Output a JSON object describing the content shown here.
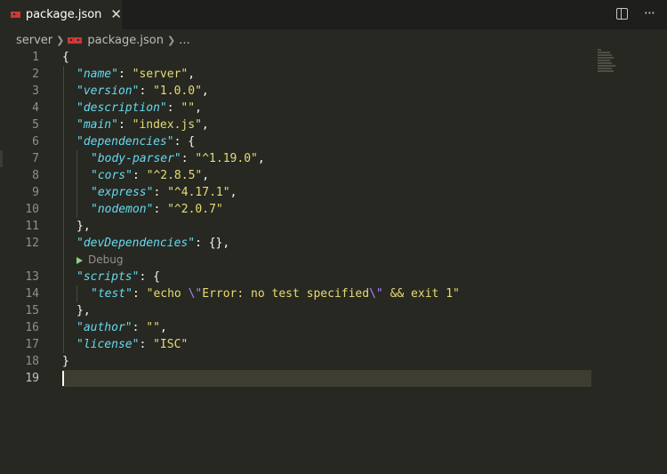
{
  "tab": {
    "label": "package.json",
    "close": "✕"
  },
  "actions": {
    "split": "split-editor",
    "more": "···"
  },
  "breadcrumb": {
    "folder": "server",
    "file": "package.json",
    "more": "..."
  },
  "codelens": {
    "debug_label": "Debug"
  },
  "lines": {
    "l1": {
      "num": "1",
      "t0": "{"
    },
    "l2": {
      "num": "2",
      "k": "\"name\"",
      "p": ": ",
      "v": "\"server\"",
      "e": ","
    },
    "l3": {
      "num": "3",
      "k": "\"version\"",
      "p": ": ",
      "v": "\"1.0.0\"",
      "e": ","
    },
    "l4": {
      "num": "4",
      "k": "\"description\"",
      "p": ": ",
      "v": "\"\"",
      "e": ","
    },
    "l5": {
      "num": "5",
      "k": "\"main\"",
      "p": ": ",
      "v": "\"index.js\"",
      "e": ","
    },
    "l6": {
      "num": "6",
      "k": "\"dependencies\"",
      "p": ": {"
    },
    "l7": {
      "num": "7",
      "k": "\"body-parser\"",
      "p": ": ",
      "v": "\"^1.19.0\"",
      "e": ","
    },
    "l8": {
      "num": "8",
      "k": "\"cors\"",
      "p": ": ",
      "v": "\"^2.8.5\"",
      "e": ","
    },
    "l9": {
      "num": "9",
      "k": "\"express\"",
      "p": ": ",
      "v": "\"^4.17.1\"",
      "e": ","
    },
    "l10": {
      "num": "10",
      "k": "\"nodemon\"",
      "p": ": ",
      "v": "\"^2.0.7\""
    },
    "l11": {
      "num": "11",
      "t0": "},"
    },
    "l12": {
      "num": "12",
      "k": "\"devDependencies\"",
      "p": ": {},"
    },
    "l13": {
      "num": "13",
      "k": "\"scripts\"",
      "p": ": {"
    },
    "l14": {
      "num": "14",
      "k": "\"test\"",
      "p": ": ",
      "v1": "\"echo ",
      "esc1": "\\\"",
      "v2": "Error: no test specified",
      "esc2": "\\\"",
      "v3": " && exit 1\""
    },
    "l15": {
      "num": "15",
      "t0": "},"
    },
    "l16": {
      "num": "16",
      "k": "\"author\"",
      "p": ": ",
      "v": "\"\"",
      "e": ","
    },
    "l17": {
      "num": "17",
      "k": "\"license\"",
      "p": ": ",
      "v": "\"ISC\""
    },
    "l18": {
      "num": "18",
      "t0": "}"
    },
    "l19": {
      "num": "19"
    }
  },
  "colors": {
    "key": "#66d9ef",
    "string": "#e6db74",
    "escape": "#ae81ff",
    "background": "#272822"
  }
}
